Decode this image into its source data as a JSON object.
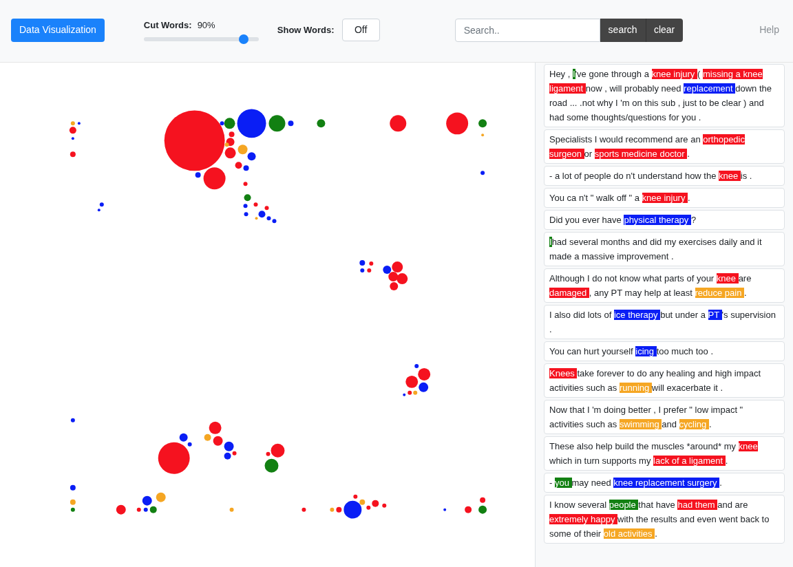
{
  "header": {
    "title_button": "Data Visualization",
    "cut_words": {
      "label": "Cut Words:",
      "reading": "90%",
      "level": 0.87
    },
    "show_words": {
      "label": "Show Words:",
      "toggle": "Off",
      "on": false
    },
    "search": {
      "placeholder": "Search..",
      "search_button": "search",
      "clear_button": "clear"
    },
    "help_link": "Help"
  },
  "sentences": [
    [
      {
        "text": "Hey , "
      },
      {
        "text": "I",
        "color": "#128012"
      },
      {
        "text": "'ve gone through a "
      },
      {
        "text": "knee injury ",
        "color": "#f5121f"
      },
      {
        "text": "( "
      },
      {
        "text": "missing a knee ligament ",
        "color": "#f5121f"
      },
      {
        "text": "now , will probably need "
      },
      {
        "text": "replacement ",
        "color": "#0a1ef5"
      },
      {
        "text": "down the road ... .not why I 'm on this sub , just to be clear ) and had some thoughts/questions for you ."
      }
    ],
    [
      {
        "text": "Specialists I would recommend are an "
      },
      {
        "text": "orthopedic surgeon ",
        "color": "#f5121f"
      },
      {
        "text": "or "
      },
      {
        "text": "sports medicine doctor ",
        "color": "#f5121f"
      },
      {
        "text": "."
      }
    ],
    [
      {
        "text": "- a lot of people do n't understand how the "
      },
      {
        "text": "knee ",
        "color": "#f5121f"
      },
      {
        "text": "is ."
      }
    ],
    [
      {
        "text": "You ca n't \" walk off \" a "
      },
      {
        "text": "knee injury ",
        "color": "#f5121f"
      },
      {
        "text": "."
      }
    ],
    [
      {
        "text": "Did you ever have "
      },
      {
        "text": "physical therapy ",
        "color": "#0a1ef5"
      },
      {
        "text": "?"
      }
    ],
    [
      {
        "text": "I",
        "color": "#128012"
      },
      {
        "text": "had several months and did my exercises daily and it made a massive improvement ."
      }
    ],
    [
      {
        "text": "Although I do not know what parts of your "
      },
      {
        "text": "knee ",
        "color": "#f5121f"
      },
      {
        "text": "are "
      },
      {
        "text": "damaged ",
        "color": "#f5121f"
      },
      {
        "text": ", any PT may help at least "
      },
      {
        "text": "reduce pain ",
        "color": "#f5a623"
      },
      {
        "text": "."
      }
    ],
    [
      {
        "text": "I also did lots of "
      },
      {
        "text": "ice therapy ",
        "color": "#0a1ef5"
      },
      {
        "text": "but under a "
      },
      {
        "text": "PT ",
        "color": "#0a1ef5"
      },
      {
        "text": "'s supervision ."
      }
    ],
    [
      {
        "text": "You can hurt yourself "
      },
      {
        "text": "icing ",
        "color": "#0a1ef5"
      },
      {
        "text": "too much too ."
      }
    ],
    [
      {
        "text": "Knees ",
        "color": "#f5121f"
      },
      {
        "text": "take forever to do any healing and high impact activities such as "
      },
      {
        "text": "running ",
        "color": "#f5a623"
      },
      {
        "text": "will exacerbate it ."
      }
    ],
    [
      {
        "text": "Now that I 'm doing better , I prefer \" low impact \" activities such as "
      },
      {
        "text": "swimming ",
        "color": "#f5a623"
      },
      {
        "text": "and "
      },
      {
        "text": "cycling ",
        "color": "#f5a623"
      },
      {
        "text": "."
      }
    ],
    [
      {
        "text": "These also help build the muscles *around* my "
      },
      {
        "text": "knee",
        "color": "#f5121f"
      },
      {
        "text": " which in turn supports my "
      },
      {
        "text": "lack of a ligament ",
        "color": "#f5121f"
      },
      {
        "text": "."
      }
    ],
    [
      {
        "text": "- "
      },
      {
        "text": "you ",
        "color": "#128012"
      },
      {
        "text": "may need "
      },
      {
        "text": "knee replacement surgery ",
        "color": "#0a1ef5"
      },
      {
        "text": "."
      }
    ],
    [
      {
        "text": "I know several "
      },
      {
        "text": "people ",
        "color": "#128012"
      },
      {
        "text": "that have "
      },
      {
        "text": "had them ",
        "color": "#f5121f"
      },
      {
        "text": "and are "
      },
      {
        "text": "extremely happy ",
        "color": "#f5121f"
      },
      {
        "text": "with the results and even went back to some of their "
      },
      {
        "text": "old activities ",
        "color": "#f5a623"
      },
      {
        "text": "."
      }
    ]
  ]
}
